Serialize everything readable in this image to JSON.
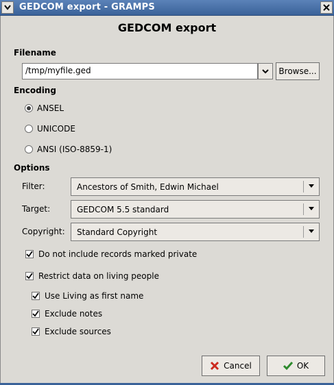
{
  "window": {
    "title": "GEDCOM export - GRAMPS",
    "heading": "GEDCOM export"
  },
  "filename": {
    "section": "Filename",
    "value": "/tmp/myfile.ged",
    "browse_label": "Browse..."
  },
  "encoding": {
    "section": "Encoding",
    "options": [
      "ANSEL",
      "UNICODE",
      "ANSI (ISO-8859-1)"
    ],
    "selected": "ANSEL"
  },
  "options": {
    "section": "Options",
    "filter": {
      "label": "Filter:",
      "value": "Ancestors of Smith, Edwin Michael"
    },
    "target": {
      "label": "Target:",
      "value": "GEDCOM 5.5 standard"
    },
    "copyright": {
      "label": "Copyright:",
      "value": "Standard Copyright"
    },
    "private": {
      "label": "Do not include records marked private",
      "checked": true
    },
    "restrict": {
      "label": "Restrict data on living people",
      "checked": true
    },
    "living_name": {
      "label": "Use Living as first name",
      "checked": true
    },
    "exclude_notes": {
      "label": "Exclude notes",
      "checked": true
    },
    "exclude_sources": {
      "label": "Exclude sources",
      "checked": true
    }
  },
  "buttons": {
    "cancel": "Cancel",
    "ok": "OK"
  }
}
